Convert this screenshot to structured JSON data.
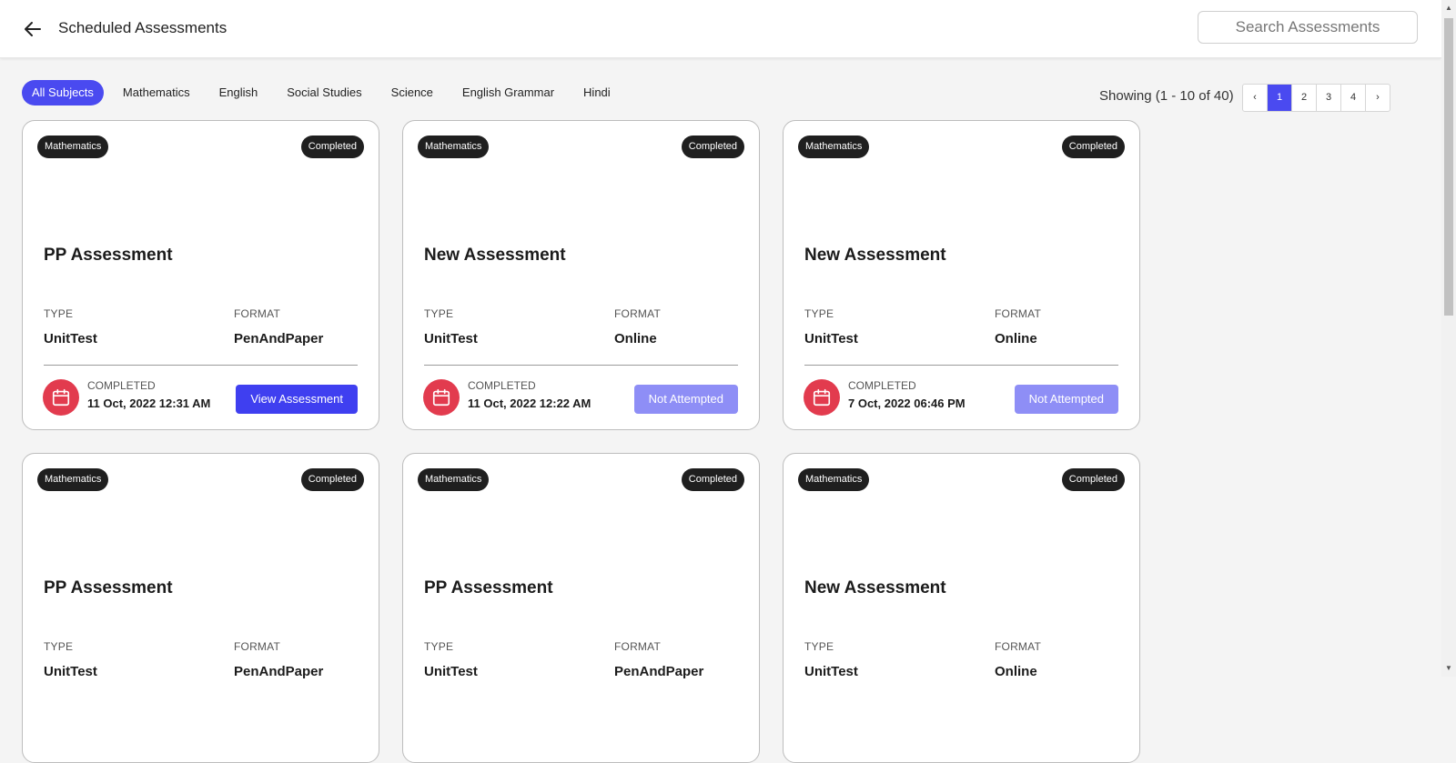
{
  "header": {
    "title": "Scheduled Assessments",
    "search_placeholder": "Search Assessments"
  },
  "subjects": [
    {
      "label": "All Subjects",
      "active": true
    },
    {
      "label": "Mathematics",
      "active": false
    },
    {
      "label": "English",
      "active": false
    },
    {
      "label": "Social Studies",
      "active": false
    },
    {
      "label": "Science",
      "active": false
    },
    {
      "label": "English Grammar",
      "active": false
    },
    {
      "label": "Hindi",
      "active": false
    }
  ],
  "pagination": {
    "showing": "Showing (1 - 10 of 40)",
    "prev": "‹",
    "pages": [
      "1",
      "2",
      "3",
      "4"
    ],
    "current": "1",
    "next": "›"
  },
  "labels": {
    "type": "TYPE",
    "format": "FORMAT",
    "completed": "COMPLETED"
  },
  "cards": [
    {
      "subject": "Mathematics",
      "status": "Completed",
      "title": "PP Assessment",
      "type": "UnitTest",
      "format": "PenAndPaper",
      "date": "11 Oct, 2022 12:31 AM",
      "action": "View Assessment",
      "action_state": "primary"
    },
    {
      "subject": "Mathematics",
      "status": "Completed",
      "title": "New Assessment",
      "type": "UnitTest",
      "format": "Online",
      "date": "11 Oct, 2022 12:22 AM",
      "action": "Not Attempted",
      "action_state": "disabled"
    },
    {
      "subject": "Mathematics",
      "status": "Completed",
      "title": "New Assessment",
      "type": "UnitTest",
      "format": "Online",
      "date": "7 Oct, 2022 06:46 PM",
      "action": "Not Attempted",
      "action_state": "disabled"
    },
    {
      "subject": "Mathematics",
      "status": "Completed",
      "title": "PP Assessment",
      "type": "UnitTest",
      "format": "PenAndPaper",
      "date": "",
      "action": "",
      "action_state": ""
    },
    {
      "subject": "Mathematics",
      "status": "Completed",
      "title": "PP Assessment",
      "type": "UnitTest",
      "format": "PenAndPaper",
      "date": "",
      "action": "",
      "action_state": ""
    },
    {
      "subject": "Mathematics",
      "status": "Completed",
      "title": "New Assessment",
      "type": "UnitTest",
      "format": "Online",
      "date": "",
      "action": "",
      "action_state": ""
    }
  ],
  "colors": {
    "accent": "#4a4af0",
    "badge_bg": "#1f1f1f",
    "calendar_bg": "#e23b4e",
    "disabled_button": "#8e8ef6"
  },
  "icons": {
    "back": "arrow-left-icon",
    "calendar": "calendar-icon"
  }
}
